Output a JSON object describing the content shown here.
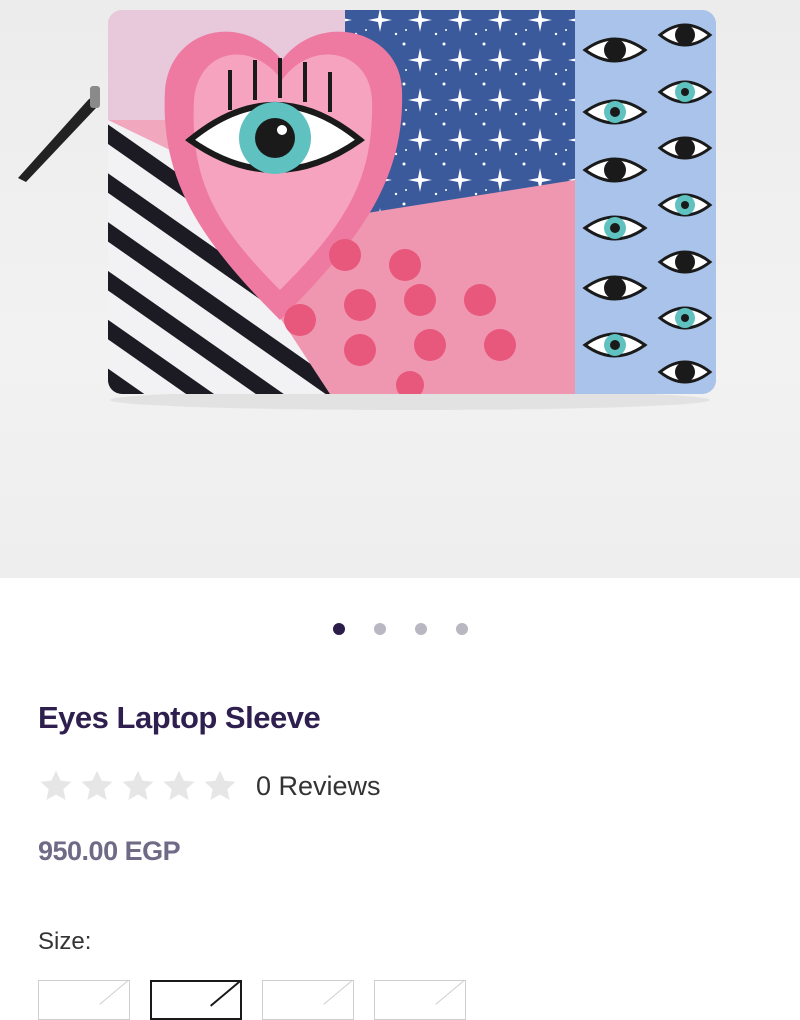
{
  "product": {
    "title": "Eyes Laptop Sleeve",
    "reviews_label": "0 Reviews",
    "rating": 0,
    "rating_max": 5,
    "price": "950.00 EGP",
    "image_alt": "Eyes laptop sleeve product photo"
  },
  "gallery": {
    "image_count": 4,
    "active_index": 0
  },
  "options": {
    "size_label": "Size:",
    "sizes": [
      "",
      "",
      "",
      ""
    ],
    "selected_index": 1
  },
  "colors": {
    "title": "#2e1f4f",
    "price": "#6f6a86",
    "dot_active": "#2b1d4a",
    "dot_inactive": "#b9b7c2",
    "star_empty": "#e6e6e6"
  }
}
